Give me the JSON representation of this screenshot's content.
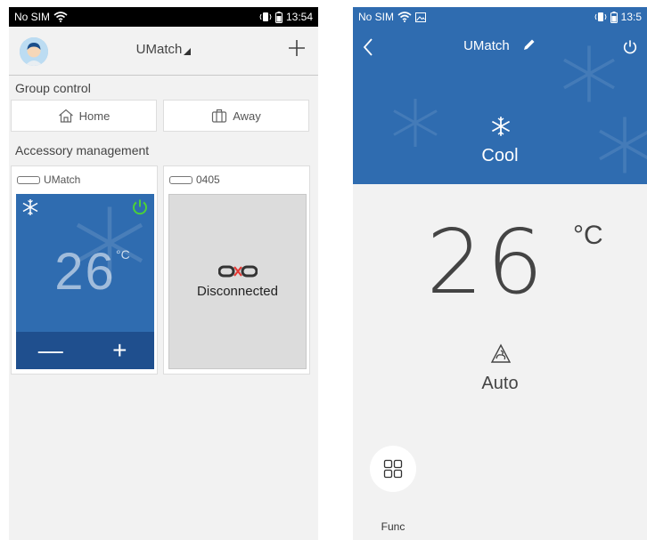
{
  "left": {
    "status": {
      "carrier": "No SIM",
      "time": "13:54"
    },
    "header": {
      "title": "UMatch"
    },
    "group_control": {
      "label": "Group control",
      "home_label": "Home",
      "away_label": "Away"
    },
    "accessory_management": {
      "label": "Accessory management",
      "devices": [
        {
          "name": "UMatch",
          "temperature": "26",
          "unit": "°C",
          "minus": "—",
          "plus": "+"
        },
        {
          "name": "0405",
          "status": "Disconnected"
        }
      ]
    }
  },
  "right": {
    "status": {
      "carrier": "No SIM",
      "time": "13:5"
    },
    "title": "UMatch",
    "mode": "Cool",
    "temperature": "26",
    "unit": "°C",
    "fan": "Auto",
    "func_label": "Func"
  },
  "colors": {
    "primary_blue": "#2f6cb0",
    "dark_blue": "#1f4f8e",
    "power_green": "#4cd137",
    "disconnect_red": "#e53935"
  }
}
